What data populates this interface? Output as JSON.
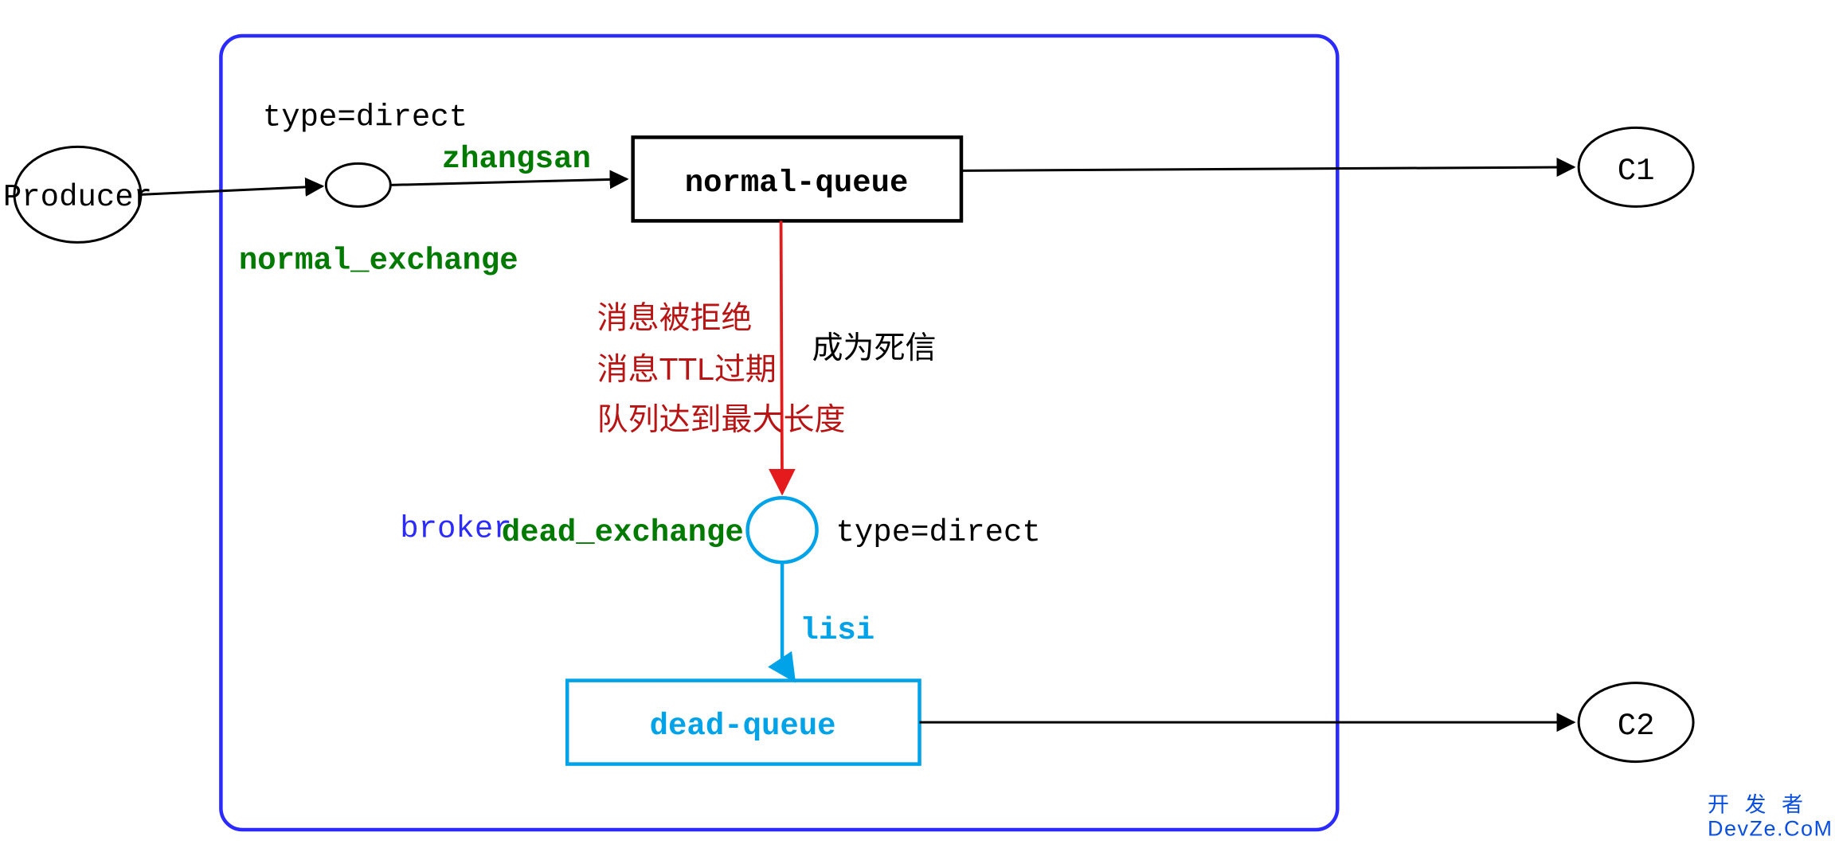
{
  "nodes": {
    "producer": "Producer",
    "c1": "C1",
    "c2": "C2",
    "normal_queue": "normal-queue",
    "dead_queue": "dead-queue"
  },
  "exchanges": {
    "normal": {
      "name": "normal_exchange",
      "type": "type=direct"
    },
    "dead": {
      "name": "dead_exchange",
      "type": "type=direct"
    }
  },
  "routing_keys": {
    "normal": "zhangsan",
    "dead": "lisi"
  },
  "broker_label": "broker",
  "dead_letter": {
    "reasons": [
      "消息被拒绝",
      "消息TTL过期",
      "队列达到最大长度"
    ],
    "become": "成为死信"
  },
  "watermark": {
    "line1": "开 发 者",
    "line2": "DevZe.CoM"
  }
}
